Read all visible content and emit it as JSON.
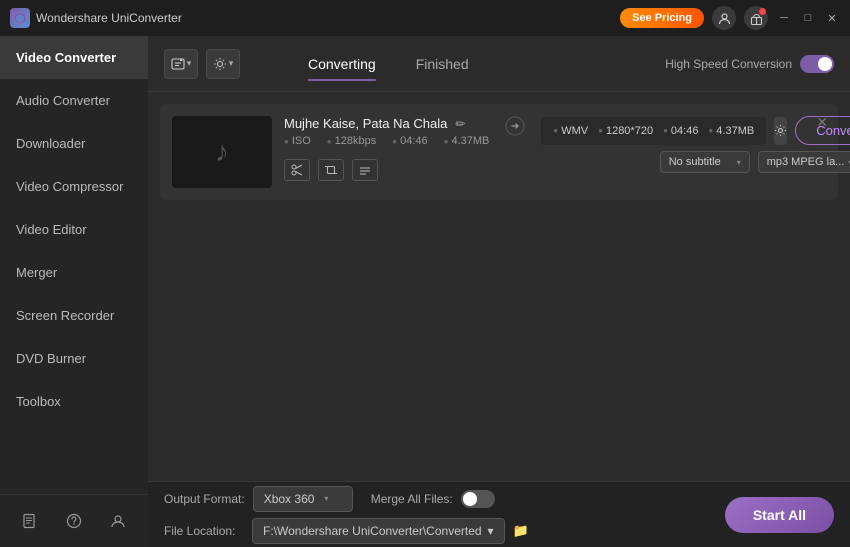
{
  "app": {
    "title": "Wondershare UniConverter",
    "logo_text": "W"
  },
  "titlebar": {
    "see_pricing": "See Pricing",
    "min_btn": "─",
    "max_btn": "□",
    "close_btn": "✕"
  },
  "sidebar": {
    "items": [
      {
        "id": "video-converter",
        "label": "Video Converter",
        "active": true
      },
      {
        "id": "audio-converter",
        "label": "Audio Converter",
        "active": false
      },
      {
        "id": "downloader",
        "label": "Downloader",
        "active": false
      },
      {
        "id": "video-compressor",
        "label": "Video Compressor",
        "active": false
      },
      {
        "id": "video-editor",
        "label": "Video Editor",
        "active": false
      },
      {
        "id": "merger",
        "label": "Merger",
        "active": false
      },
      {
        "id": "screen-recorder",
        "label": "Screen Recorder",
        "active": false
      },
      {
        "id": "dvd-burner",
        "label": "DVD Burner",
        "active": false
      },
      {
        "id": "toolbox",
        "label": "Toolbox",
        "active": false
      }
    ],
    "bottom_icons": [
      "📖",
      "?",
      "👤"
    ]
  },
  "topbar": {
    "add_btn_label": "+",
    "dropdown_btn_label": "▾",
    "high_speed_label": "High Speed Conversion",
    "tabs": [
      {
        "id": "converting",
        "label": "Converting",
        "active": true
      },
      {
        "id": "finished",
        "label": "Finished",
        "active": false
      }
    ]
  },
  "file_item": {
    "title": "Mujhe Kaise, Pata Na Chala",
    "thumb_icon": "♪",
    "source_meta": [
      {
        "label": "ISO"
      },
      {
        "label": "128kbps"
      },
      {
        "label": "04:46"
      },
      {
        "label": "4.37MB"
      }
    ],
    "output_meta": [
      {
        "label": "WMV"
      },
      {
        "label": "1280*720"
      },
      {
        "label": "04:46"
      },
      {
        "label": "4.37MB"
      }
    ],
    "subtitle_dropdown": "No subtitle",
    "format_dropdown": "mp3 MPEG la...",
    "convert_btn": "Convert"
  },
  "bottom_bar": {
    "output_format_label": "Output Format:",
    "output_format_value": "Xbox 360",
    "merge_label": "Merge All Files:",
    "file_location_label": "File Location:",
    "file_location_value": "F:\\Wondershare UniConverter\\Converted",
    "start_all_btn": "Start All"
  }
}
